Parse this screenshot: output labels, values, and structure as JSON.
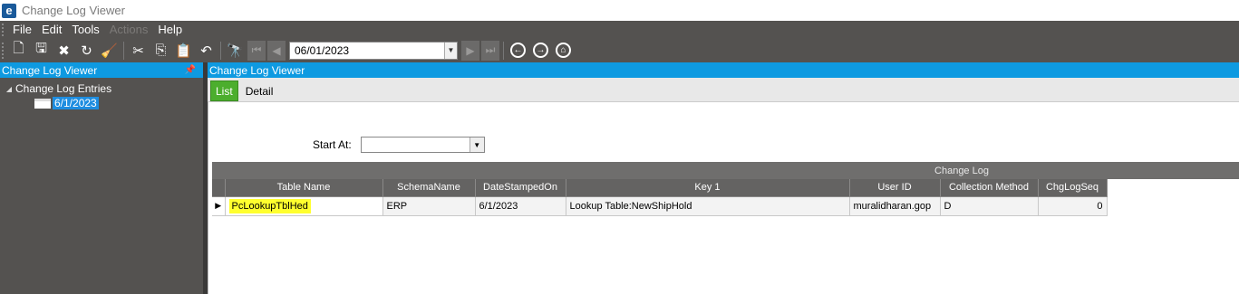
{
  "app": {
    "title": "Change Log Viewer",
    "logo_letter": "e"
  },
  "menu": [
    {
      "label": "File",
      "enabled": true
    },
    {
      "label": "Edit",
      "enabled": true
    },
    {
      "label": "Tools",
      "enabled": true
    },
    {
      "label": "Actions",
      "enabled": false
    },
    {
      "label": "Help",
      "enabled": true
    }
  ],
  "toolbar": {
    "date_value": "06/01/2023"
  },
  "left_pane": {
    "title": "Change Log Viewer",
    "tree_root": "Change Log Entries",
    "tree_child": "6/1/2023"
  },
  "right_pane": {
    "title": "Change Log Viewer",
    "tabs": [
      {
        "label": "List",
        "active": true
      },
      {
        "label": "Detail",
        "active": false
      }
    ],
    "start_at_label": "Start At:",
    "start_at_value": ""
  },
  "grid": {
    "band": "Change Log",
    "columns": [
      "Table Name",
      "SchemaName",
      "DateStampedOn",
      "Key 1",
      "User ID",
      "Collection Method",
      "ChgLogSeq"
    ],
    "rows": [
      [
        "PcLookupTblHed",
        "ERP",
        "6/1/2023",
        "Lookup Table:NewShipHold",
        "muralidharan.gop",
        "D",
        "0"
      ]
    ]
  },
  "colors": {
    "accent": "#0e9ae1",
    "dark": "#545250",
    "tab_active": "#4cae2e",
    "highlight": "#ffff2e"
  }
}
